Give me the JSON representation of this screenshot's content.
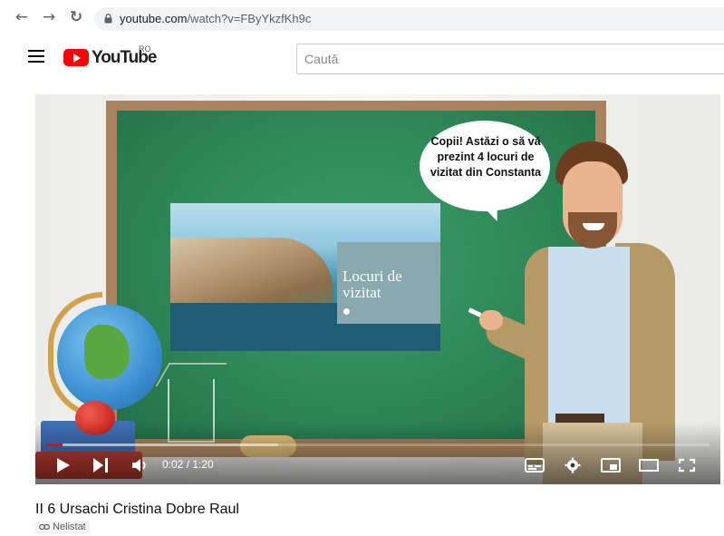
{
  "browser": {
    "url_host": "youtube.com",
    "url_path": "/watch?v=FByYkzfKh9c"
  },
  "header": {
    "logo_text": "YouTube",
    "country_code": "RO",
    "search_placeholder": "Caută"
  },
  "video": {
    "slide_title": "Locuri de vizitat",
    "speech_bubble": "Copii! Astăzi o să vă prezint 4 locuri de vizitat din Constanta",
    "time": "0:02 / 1:20",
    "progress_played": 0.025,
    "progress_loaded": 0.35
  },
  "meta": {
    "title": "II 6 Ursachi Cristina Dobre Raul",
    "badge": "Nelistat"
  },
  "icons": [
    "back-icon",
    "forward-icon",
    "reload-icon",
    "lock-icon",
    "menu-icon",
    "play-icon",
    "next-icon",
    "volume-icon",
    "subtitles-icon",
    "settings-icon",
    "miniplayer-icon",
    "theater-icon",
    "fullscreen-icon",
    "link-icon"
  ]
}
